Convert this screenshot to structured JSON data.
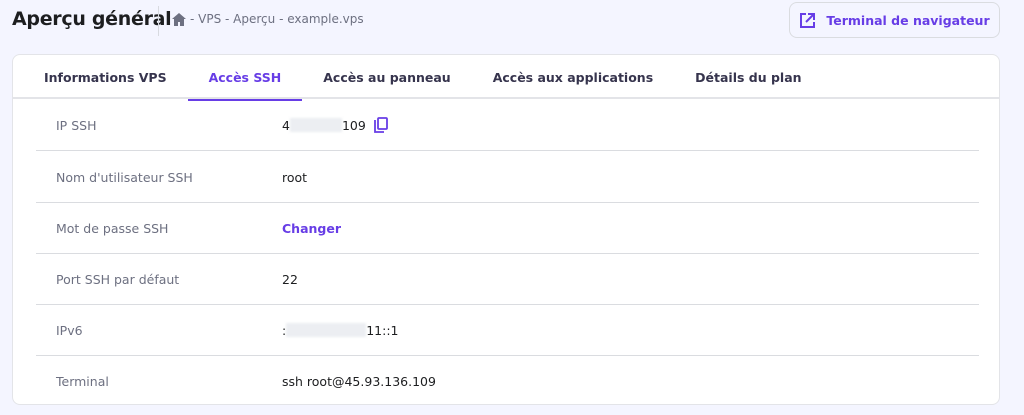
{
  "header": {
    "title": "Aperçu général",
    "breadcrumb": "- VPS - Aperçu - example.vps",
    "terminal_button": "Terminal de navigateur"
  },
  "tabs": [
    {
      "label": "Informations VPS"
    },
    {
      "label": "Accès SSH"
    },
    {
      "label": "Accès au panneau"
    },
    {
      "label": "Accès aux applications"
    },
    {
      "label": "Détails du plan"
    }
  ],
  "rows": [
    {
      "label": "IP SSH",
      "prefix": "4",
      "suffix": "109"
    },
    {
      "label": "Nom d'utilisateur SSH",
      "value": "root"
    },
    {
      "label": "Mot de passe SSH",
      "value": "Changer"
    },
    {
      "label": "Port SSH par défaut",
      "value": "22"
    },
    {
      "label": "IPv6",
      "prefix": ":",
      "suffix": "11::1"
    },
    {
      "label": "Terminal",
      "value": "ssh root@45.93.136.109"
    }
  ],
  "colors": {
    "accent": "#673de6",
    "background": "#f4f5ff"
  }
}
